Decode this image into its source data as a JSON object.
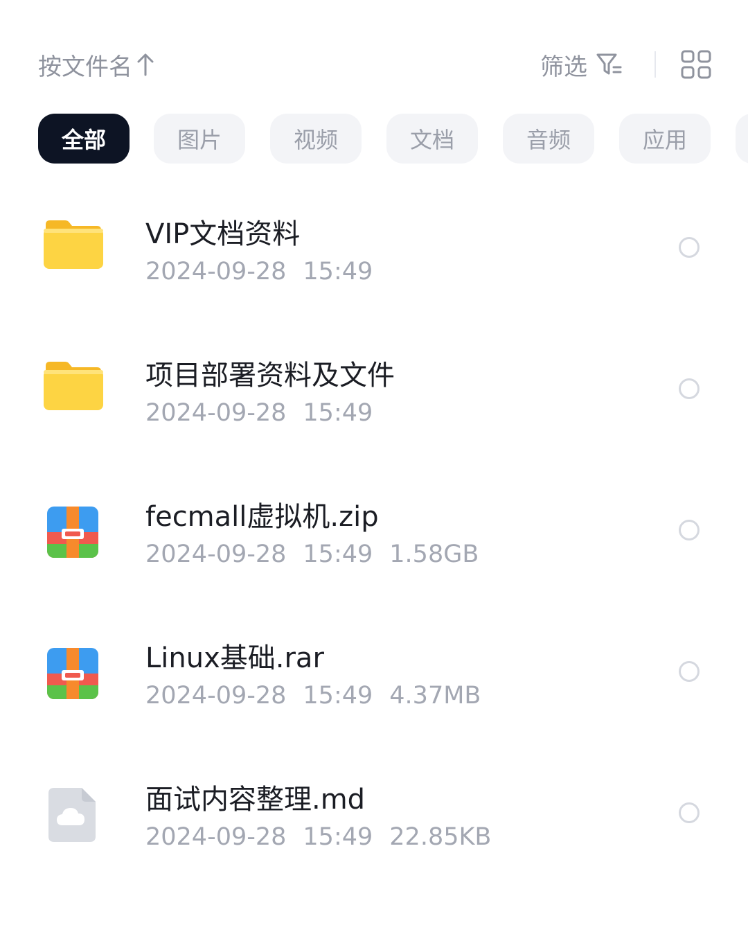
{
  "toolbar": {
    "sort_label": "按文件名",
    "sort_icon": "arrow-up-icon",
    "filter_label": "筛选",
    "filter_icon": "filter-icon",
    "view_icon": "grid-view-icon"
  },
  "tabs": [
    {
      "label": "全部",
      "active": true
    },
    {
      "label": "图片",
      "active": false
    },
    {
      "label": "视频",
      "active": false
    },
    {
      "label": "文档",
      "active": false
    },
    {
      "label": "音频",
      "active": false
    },
    {
      "label": "应用",
      "active": false
    }
  ],
  "files": [
    {
      "name": "VIP文档资料",
      "date": "2024-09-28",
      "time": "15:49",
      "size": "",
      "icon": "folder-icon"
    },
    {
      "name": "项目部署资料及文件",
      "date": "2024-09-28",
      "time": "15:49",
      "size": "",
      "icon": "folder-icon"
    },
    {
      "name": "fecmall虚拟机.zip",
      "date": "2024-09-28",
      "time": "15:49",
      "size": "1.58GB",
      "icon": "archive-icon"
    },
    {
      "name": "Linux基础.rar",
      "date": "2024-09-28",
      "time": "15:49",
      "size": "4.37MB",
      "icon": "archive-icon"
    },
    {
      "name": "面试内容整理.md",
      "date": "2024-09-28",
      "time": "15:49",
      "size": "22.85KB",
      "icon": "cloud-document-icon"
    }
  ],
  "colors": {
    "active_chip_bg": "#0d1424",
    "chip_bg": "#f3f4f7",
    "folder_yellow": "#fdd443",
    "muted_text": "#a3a7b2"
  }
}
